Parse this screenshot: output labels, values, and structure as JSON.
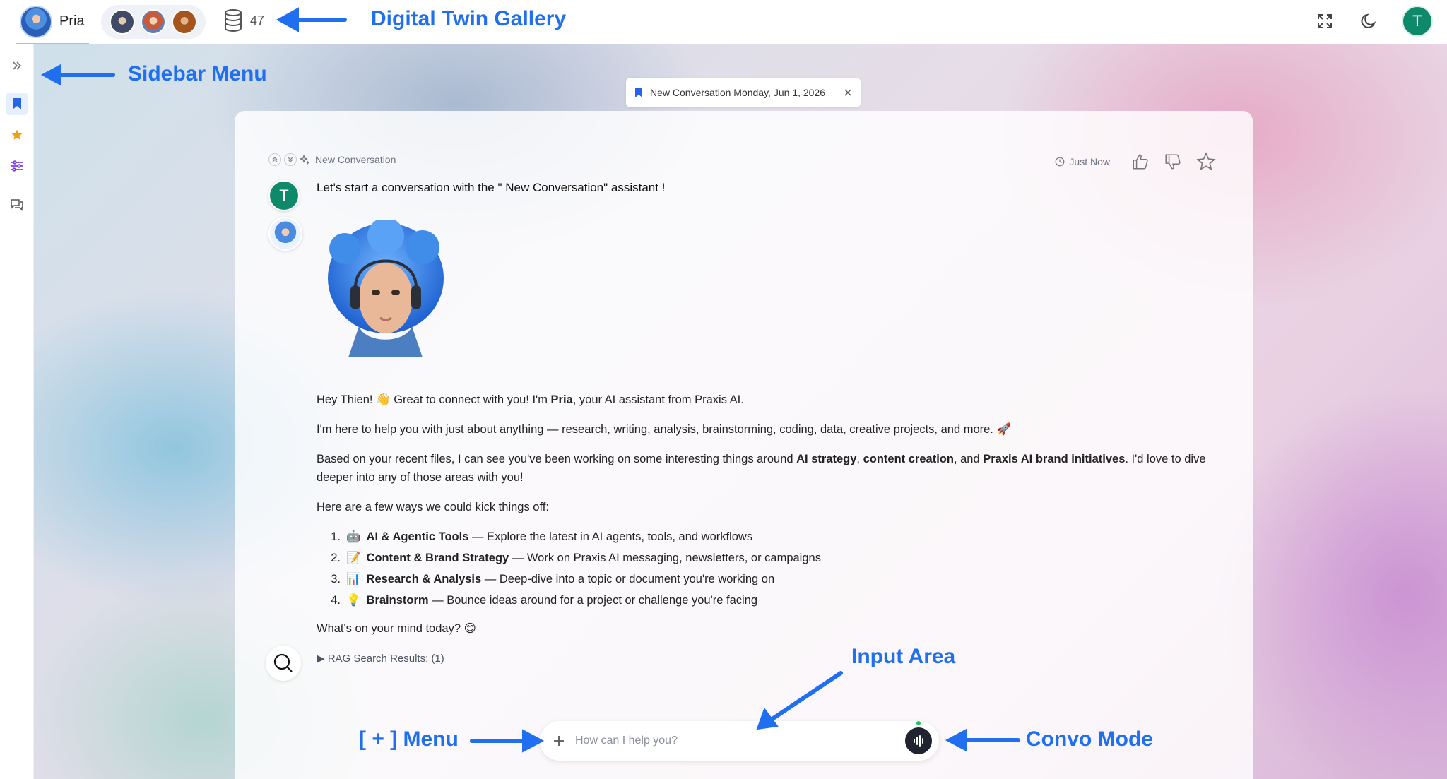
{
  "topbar": {
    "active_twin": "Pria",
    "data_count": "47",
    "icons": [
      "database-icon",
      "fullscreen-icon",
      "moon-icon"
    ],
    "user_initial": "T"
  },
  "sidebar": {
    "items": [
      {
        "icon": "expand-icon"
      },
      {
        "icon": "bookmark-icon",
        "active": true
      },
      {
        "icon": "star-icon"
      },
      {
        "icon": "sliders-icon"
      },
      {
        "icon": "chat-icon"
      }
    ]
  },
  "tab": {
    "label": "New Conversation Monday, Jun 1, 2026"
  },
  "conversation": {
    "title": "New Conversation",
    "time": "Just Now",
    "user_initial": "T",
    "user_message": "Let's start a conversation with the \" New Conversation\" assistant !",
    "reply": {
      "greeting_pre": "Hey Thien! 👋 Great to connect with you! I'm ",
      "greeting_name": "Pria",
      "greeting_post": ", your AI assistant from Praxis AI.",
      "help": "I'm here to help you with just about anything — research, writing, analysis, brainstorming, coding, data, creative projects, and more. 🚀",
      "files_pre": "Based on your recent files, I can see you've been working on some interesting things around ",
      "files_b1": "AI strategy",
      "files_sep1": ", ",
      "files_b2": "content creation",
      "files_sep2": ", and ",
      "files_b3": "Praxis AI brand initiatives",
      "files_post": ". I'd love to dive deeper into any of those areas with you!",
      "intro": "Here are a few ways we could kick things off:",
      "options": [
        {
          "num": "1.",
          "emoji": "🤖",
          "title": "AI & Agentic Tools",
          "desc": " — Explore the latest in AI agents, tools, and workflows"
        },
        {
          "num": "2.",
          "emoji": "📝",
          "title": "Content & Brand Strategy",
          "desc": " — Work on Praxis AI messaging, newsletters, or campaigns"
        },
        {
          "num": "3.",
          "emoji": "📊",
          "title": "Research & Analysis",
          "desc": " — Deep-dive into a topic or document you're working on"
        },
        {
          "num": "4.",
          "emoji": "💡",
          "title": "Brainstorm",
          "desc": " — Bounce ideas around for a project or challenge you're facing"
        }
      ],
      "closing": "What's on your mind today? 😊"
    },
    "rag": "▶ RAG Search Results: (1)"
  },
  "input": {
    "placeholder": "How can I help you?",
    "value": ""
  },
  "annotations": {
    "gallery": "Digital Twin Gallery",
    "sidebar": "Sidebar Menu",
    "input_area": "Input Area",
    "plus_menu": "[ + ] Menu",
    "convo_mode": "Convo Mode"
  },
  "colors": {
    "accent": "#1f6ff0",
    "user_avatar": "#0e8a6a",
    "live_dot": "#22c55e"
  }
}
